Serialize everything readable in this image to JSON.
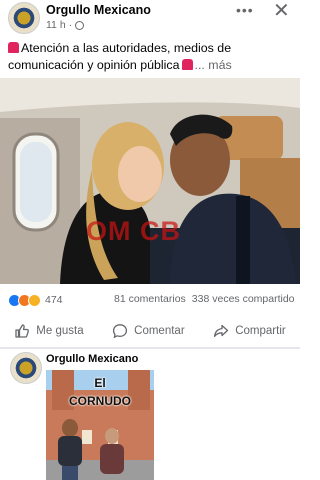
{
  "post": {
    "author": "Orgullo Mexicano",
    "time": "11 h",
    "caption": "Atención a las autoridades, medios de comunicación y opinión pública",
    "more_label": "... más",
    "watermark": "OM CB",
    "reactions_count": "474",
    "comments": "81 comentarios",
    "shares": "338 veces compartido",
    "icons": [
      "globe-icon",
      "siren-icon",
      "like-reaction-icon",
      "angry-reaction-icon",
      "wow-reaction-icon"
    ]
  },
  "actions": {
    "like": "Me gusta",
    "comment": "Comentar",
    "share": "Compartir"
  },
  "next_post": {
    "author": "Orgullo Mexicano",
    "overlay_line1": "El",
    "overlay_line2": "CORNUDO"
  },
  "colors": {
    "brand_blue": "#1877f2",
    "muted_text": "#65676b",
    "watermark_red": "#c81414"
  }
}
